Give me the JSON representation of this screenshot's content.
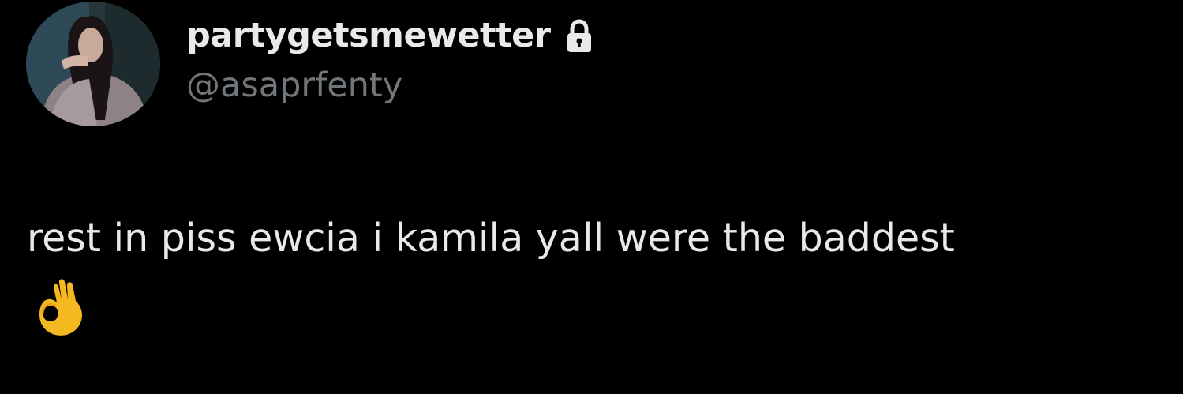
{
  "tweet": {
    "author": {
      "display_name": "partygetsmewetter",
      "handle": "@asaprfenty",
      "protected": true,
      "avatar_icon": "profile-photo"
    },
    "text": "rest in piss ewcia i kamila yall were the baddest",
    "emoji_icon": "ok-hand-icon"
  },
  "colors": {
    "background": "#000000",
    "primary_text": "#e7e9ea",
    "secondary_text": "#71767b"
  }
}
